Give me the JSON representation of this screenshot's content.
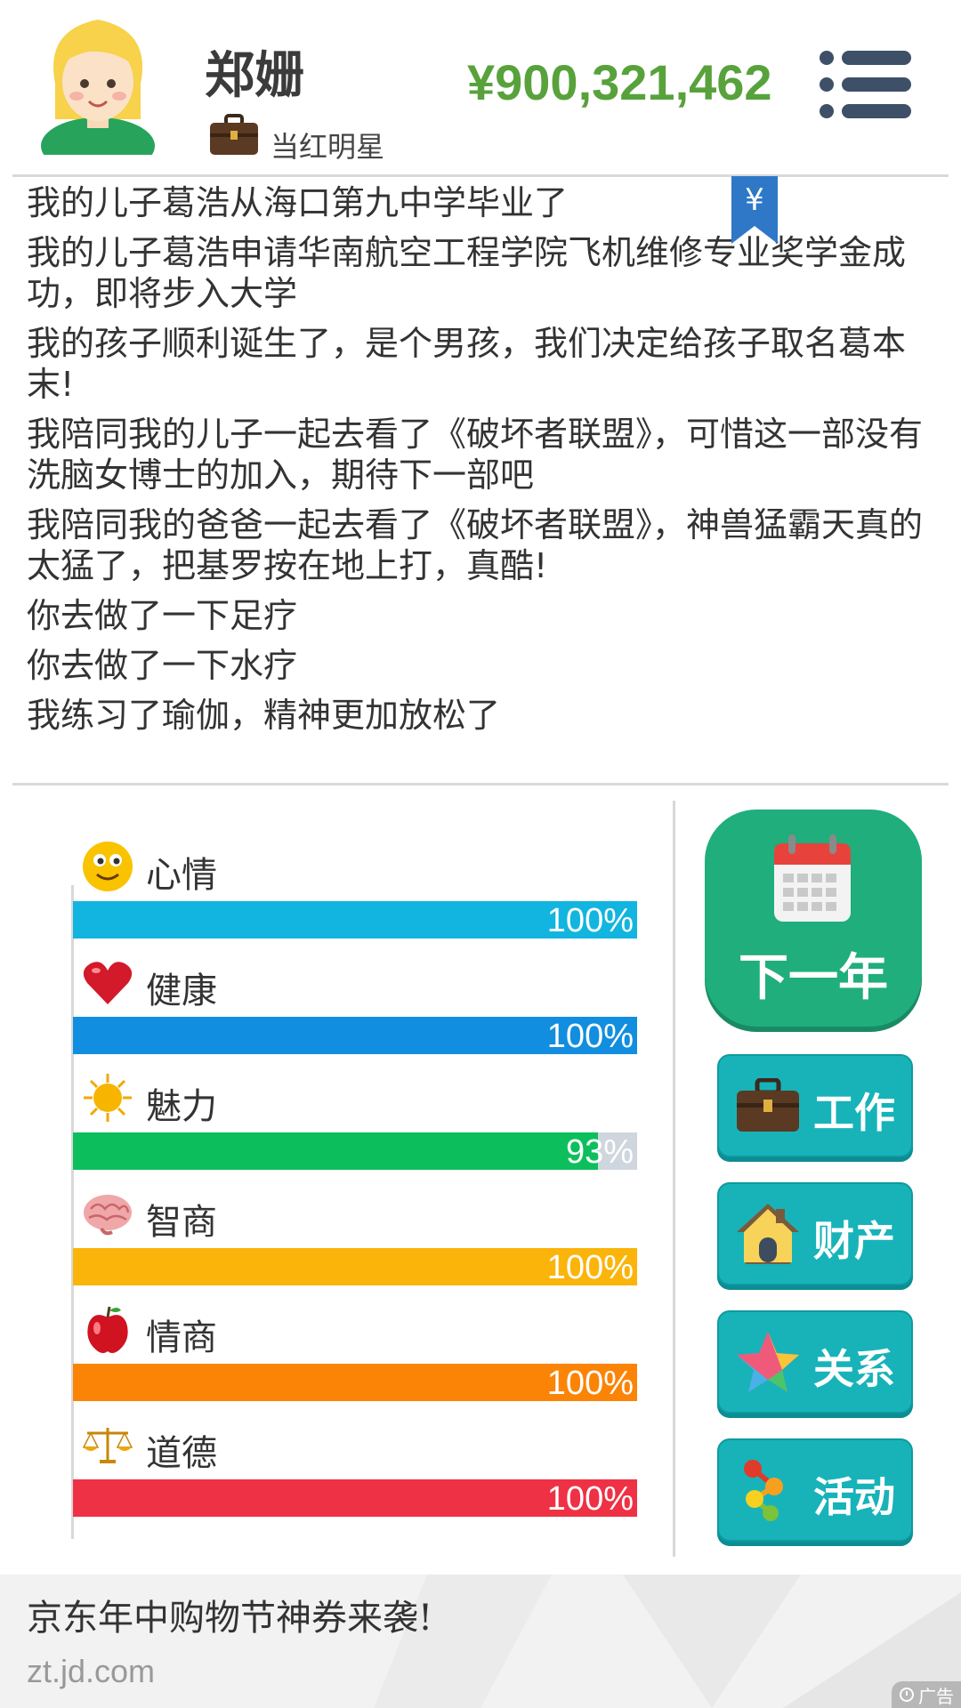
{
  "header": {
    "player_name": "郑姗",
    "occupation": "当红明星",
    "money": "¥900,321,462"
  },
  "bookmark_symbol": "¥",
  "events": [
    "我的儿子葛浩从海口第九中学毕业了",
    "我的儿子葛浩申请华南航空工程学院飞机维修专业奖学金成功，即将步入大学",
    "我的孩子顺利诞生了，是个男孩，我们决定给孩子取名葛本末!",
    "我陪同我的儿子一起去看了《破坏者联盟》，可惜这一部没有洗脑女博士的加入，期待下一部吧",
    "我陪同我的爸爸一起去看了《破坏者联盟》，神兽猛霸天真的太猛了，把基罗按在地上打，真酷!",
    "你去做了一下足疗",
    "你去做了一下水疗",
    "我练习了瑜伽，精神更加放松了"
  ],
  "stats": [
    {
      "name": "心情",
      "percent": 100,
      "label": "100%",
      "color": "#12b5df",
      "icon": "smiley-icon"
    },
    {
      "name": "健康",
      "percent": 100,
      "label": "100%",
      "color": "#128ee0",
      "icon": "heart-icon"
    },
    {
      "name": "魅力",
      "percent": 93,
      "label": "93%",
      "color": "#0dbf5c",
      "icon": "sun-icon"
    },
    {
      "name": "智商",
      "percent": 100,
      "label": "100%",
      "color": "#fbb40a",
      "icon": "brain-icon"
    },
    {
      "name": "情商",
      "percent": 100,
      "label": "100%",
      "color": "#fb8406",
      "icon": "apple-icon"
    },
    {
      "name": "道德",
      "percent": 100,
      "label": "100%",
      "color": "#ef3145",
      "icon": "scales-icon"
    }
  ],
  "buttons": {
    "next_year": "下一年",
    "work": "工作",
    "property": "财产",
    "relations": "关系",
    "activities": "活动"
  },
  "ad": {
    "title": "京东年中购物节神券来袭!",
    "url": "zt.jd.com",
    "badge": "广告"
  },
  "colors": {
    "money": "#58a23c",
    "next_year_button": "#1fae7c",
    "side_button": "#17b3b9"
  }
}
